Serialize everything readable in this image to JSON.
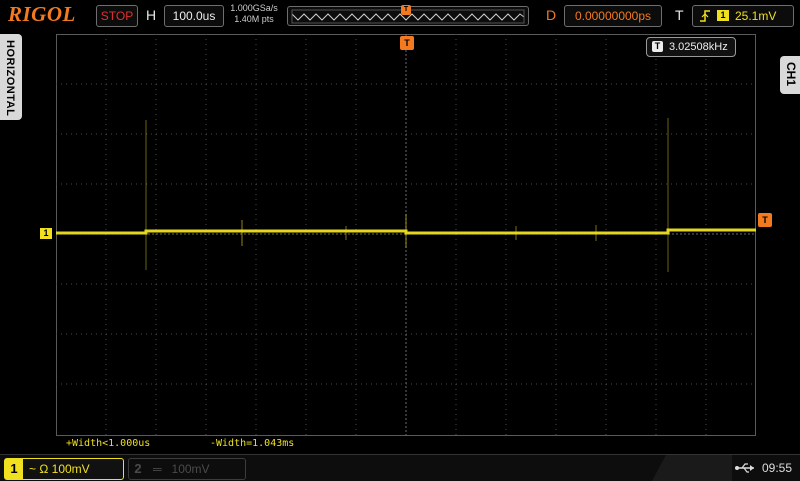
{
  "brand": "RIGOL",
  "run_state": "STOP",
  "horizontal": {
    "label": "H",
    "timebase": "100.0us",
    "sample_rate": "1.000GSa/s",
    "memory_depth": "1.40M pts"
  },
  "delay": {
    "label": "D",
    "value": "0.00000000ps"
  },
  "trigger": {
    "label": "T",
    "edge_icon": "rising-edge-icon",
    "source": "1",
    "level": "25.1mV",
    "marker": "T"
  },
  "side_tabs": {
    "left": "HORIZONTAL",
    "right": "CH1"
  },
  "frequency_readout": {
    "marker": "T",
    "value": "3.02508kHz"
  },
  "channel_marker": "1",
  "measurements": {
    "pos_width": "+Width<1.000us",
    "neg_width": "-Width=1.043ms"
  },
  "channels": [
    {
      "number": "1",
      "coupling": "~ Ω",
      "scale": "100mV",
      "active": true
    },
    {
      "number": "2",
      "coupling": "═",
      "scale": "100mV",
      "active": false
    }
  ],
  "status": {
    "usb_icon": "usb-icon",
    "time": "09:55"
  },
  "colors": {
    "ch1": "#f0e020",
    "trigger": "#f47a20",
    "stop": "#e03030",
    "grid": "#4a4a4a"
  }
}
